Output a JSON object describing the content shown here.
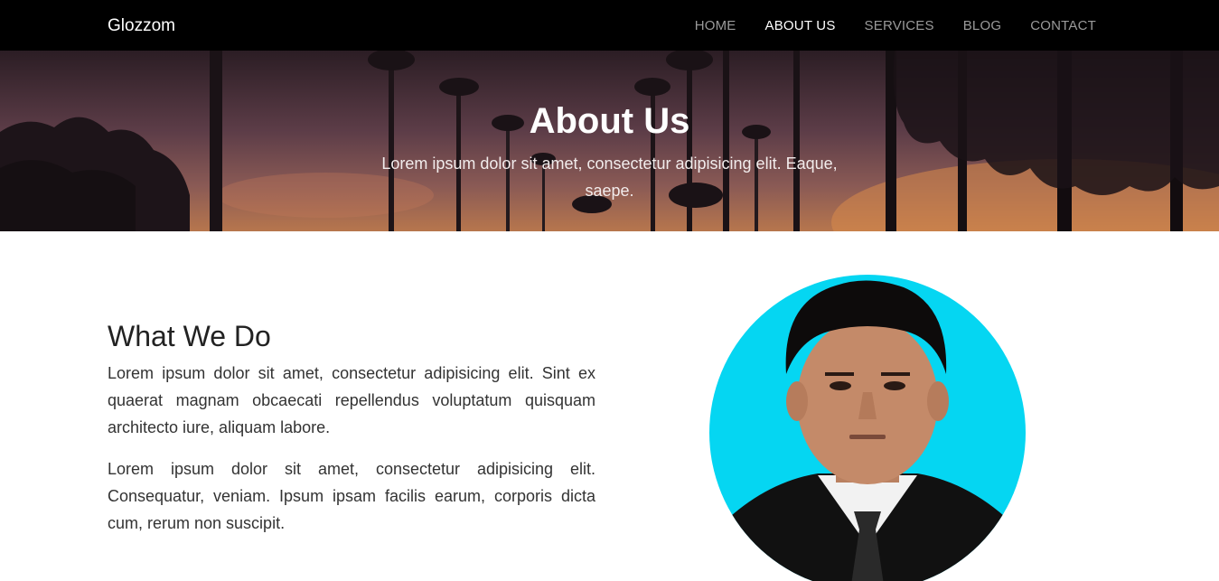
{
  "navbar": {
    "brand": "Glozzom",
    "items": [
      {
        "label": "HOME",
        "active": false
      },
      {
        "label": "ABOUT US",
        "active": true
      },
      {
        "label": "SERVICES",
        "active": false
      },
      {
        "label": "BLOG",
        "active": false
      },
      {
        "label": "CONTACT",
        "active": false
      }
    ]
  },
  "hero": {
    "title": "About Us",
    "subtitle": "Lorem ipsum dolor sit amet, consectetur adipisicing elit. Eaque, saepe."
  },
  "section": {
    "title": "What We Do",
    "paragraphs": [
      "Lorem ipsum dolor sit amet, consectetur adipisicing elit. Sint ex quaerat magnam obcaecati repellendus voluptatum quisquam architecto iure, aliquam labore.",
      "Lorem ipsum dolor sit amet, consectetur adipisicing elit. Consequatur, veniam. Ipsum ipsam facilis earum, corporis dicta cum, rerum non suscipit."
    ]
  },
  "colors": {
    "navbar_bg": "#000000",
    "nav_active": "#ffffff",
    "nav_inactive": "#9a9a9a",
    "avatar_bg": "#05d6f2"
  }
}
